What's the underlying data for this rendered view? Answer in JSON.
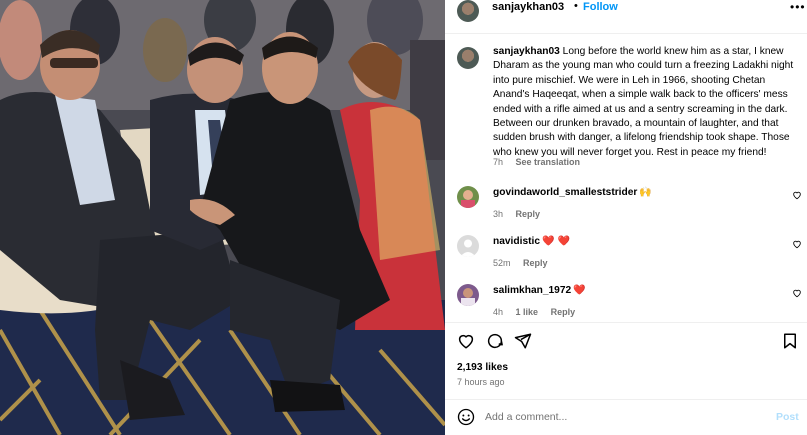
{
  "post": {
    "username": "sanjaykhan03",
    "follow_label": "Follow",
    "dot": "•",
    "more_label": "•••",
    "caption_user": "sanjaykhan03",
    "caption_text": "Long before the world knew him as a star, I knew Dharam as the young man who could turn a freezing Ladakhi night into pure mischief. We were in Leh in 1966, shooting Chetan Anand's Haqeeqat, when a simple walk back to the officers' mess ended with a rifle aimed at us and a sentry screaming in the dark. Between our drunken bravado, a mountain of laughter, and that sudden brush with danger, a lifelong friendship took shape. Those who knew you will never forget you. Rest in peace my friend!",
    "caption_time": "7h",
    "see_translation": "See translation"
  },
  "comments": [
    {
      "user": "govindaworld_smalleststrider",
      "emoji": "🙌",
      "time": "3h",
      "likes": "",
      "reply": "Reply",
      "avatar_color": "#5b7a3d"
    },
    {
      "user": "navidistic",
      "emoji": "❤️ ❤️",
      "time": "52m",
      "likes": "",
      "reply": "Reply",
      "avatar_color": "#b8b8b8"
    },
    {
      "user": "salimkhan_1972",
      "emoji": "❤️",
      "time": "4h",
      "likes": "1 like",
      "reply": "Reply",
      "avatar_color": "#6a4a7c"
    }
  ],
  "actions": {
    "like_icon": "heart-icon",
    "comment_icon": "comment-icon",
    "share_icon": "share-icon",
    "save_icon": "bookmark-icon"
  },
  "stats": {
    "likes": "2,193 likes",
    "posted": "7 hours ago"
  },
  "add_comment": {
    "placeholder": "Add a comment...",
    "post_label": "Post"
  },
  "colors": {
    "accent": "#0095f6",
    "post_disabled": "#b2dffc",
    "muted": "#737373",
    "heart": "#e0245e"
  }
}
